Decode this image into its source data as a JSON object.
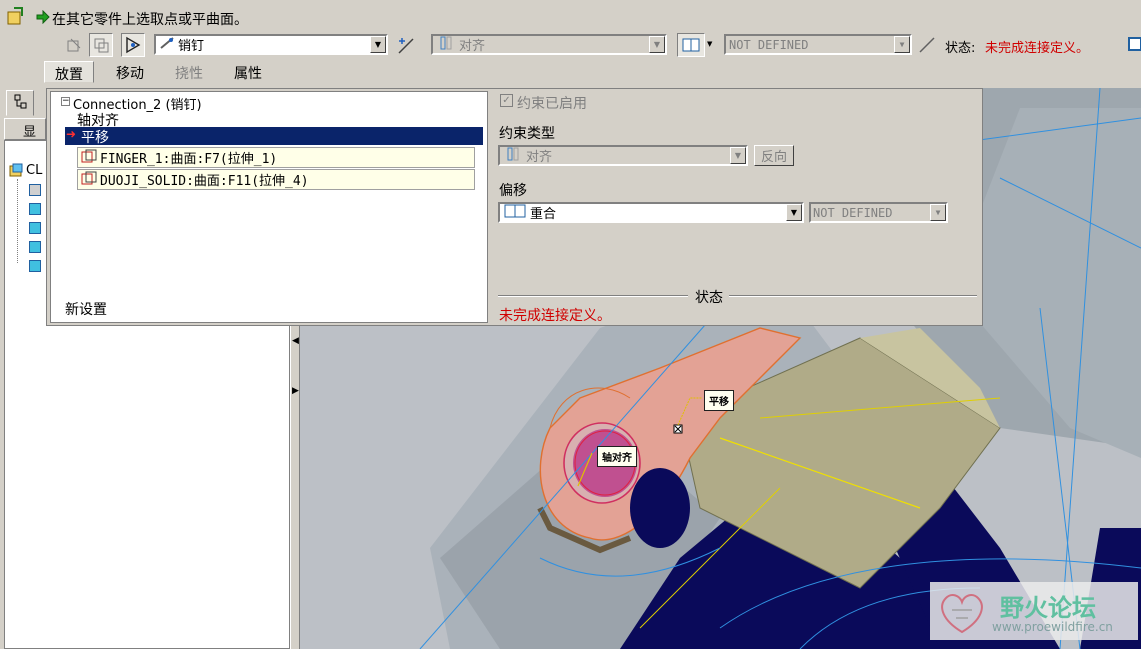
{
  "prompt": "在其它零件上选取点或平曲面。",
  "toolbar": {
    "connection_type": "销钉",
    "constraint_type": "对齐",
    "offset_value": "NOT DEFINED",
    "status_label": "状态:",
    "status_text": "未完成连接定义。"
  },
  "tabs": [
    "放置",
    "移动",
    "挠性",
    "属性"
  ],
  "left_tree": {
    "show_label": "显示",
    "root_label": "CL"
  },
  "placement": {
    "connection_title": "Connection_2 (销钉)",
    "constraint_axis": "轴对齐",
    "constraint_translate": "平移",
    "ref1": "FINGER_1:曲面:F7(拉伸_1)",
    "ref2": "DUOJI_SOLID:曲面:F11(拉伸_4)",
    "new_set": "新设置",
    "enabled_label": "约束已启用",
    "constraint_type_label": "约束类型",
    "constraint_type_value": "对齐",
    "flip_button": "反向",
    "offset_label": "偏移",
    "offset_type": "重合",
    "offset_value": "NOT DEFINED",
    "status_heading": "状态",
    "status_text": "未完成连接定义。"
  },
  "viewport": {
    "callout_translate": "平移",
    "callout_axis": "轴对齐"
  },
  "watermark": {
    "title": "野火论坛",
    "url": "www.proewildfire.cn"
  },
  "colors": {
    "status_red": "#d00000",
    "selection_blue": "#0a246a",
    "part_pink": "#e3a295",
    "part_olive": "#b0ab88",
    "navy": "#0a0a5a"
  }
}
